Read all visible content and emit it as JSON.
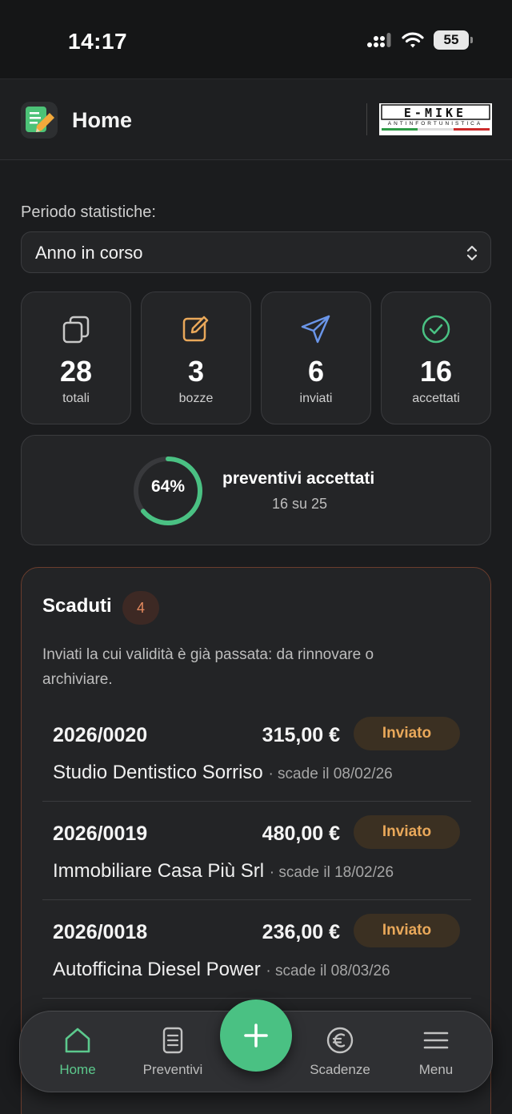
{
  "status_bar": {
    "time": "14:17",
    "battery": "55"
  },
  "header": {
    "title": "Home",
    "logo_text": "E-MIKE",
    "logo_subtext": "ANTINFORTUNISTICA"
  },
  "period": {
    "label": "Periodo statistiche:",
    "selected": "Anno in corso"
  },
  "stats": [
    {
      "value": "28",
      "label": "totali",
      "icon": "copy-icon"
    },
    {
      "value": "3",
      "label": "bozze",
      "icon": "edit-icon"
    },
    {
      "value": "6",
      "label": "inviati",
      "icon": "send-icon"
    },
    {
      "value": "16",
      "label": "accettati",
      "icon": "check-circle-icon"
    }
  ],
  "acceptance": {
    "percent_label": "64%",
    "percent": 0.64,
    "title": "preventivi accettati",
    "subtitle": "16 su 25"
  },
  "expired": {
    "title": "Scaduti",
    "count": "4",
    "description": "Inviati la cui validità è già passata: da rinnovare o archiviare.",
    "quotes": [
      {
        "number": "2026/0020",
        "amount": "315,00 €",
        "status": "Inviato",
        "client": "Studio Dentistico Sorriso",
        "due": "· scade il 08/02/26"
      },
      {
        "number": "2026/0019",
        "amount": "480,00 €",
        "status": "Inviato",
        "client": "Immobiliare Casa Più Srl",
        "due": "· scade il 18/02/26"
      },
      {
        "number": "2026/0018",
        "amount": "236,00 €",
        "status": "Inviato",
        "client": "Autofficina Diesel Power",
        "due": "· scade il 08/03/26"
      }
    ]
  },
  "nav": {
    "home": "Home",
    "quotes": "Preventivi",
    "deadlines": "Scadenze",
    "menu": "Menu"
  },
  "colors": {
    "accent": "#4ac183",
    "warning": "#e9a85a",
    "expired_border": "#6b3d2d"
  }
}
